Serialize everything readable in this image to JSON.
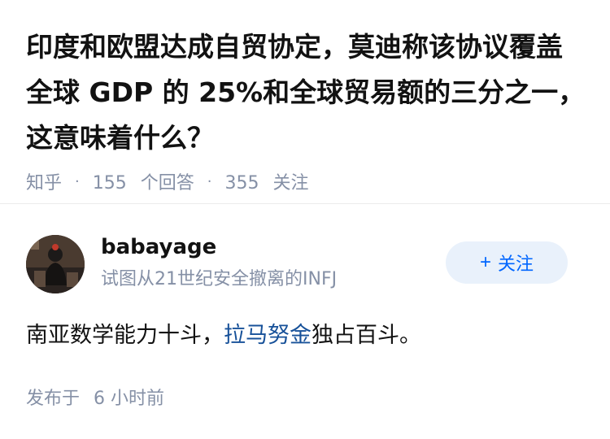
{
  "question": {
    "title": "印度和欧盟达成自贸协定，莫迪称该协议覆盖全球 GDP 的 25%和全球贸易额的三分之一，这意味着什么？",
    "source": "知乎",
    "answers_count": "155",
    "answers_label": "个回答",
    "followers_count": "355",
    "followers_label": "关注"
  },
  "author": {
    "name": "babayage",
    "bio": "试图从21世纪安全撤离的INFJ",
    "follow_plus": "+",
    "follow_label": "关注"
  },
  "answer": {
    "text_before": "南亚数学能力十斗，",
    "link_text": "拉马努金",
    "text_after": "独占百斗。"
  },
  "footer": {
    "posted_label": "发布于",
    "posted_time": "6 小时前"
  },
  "colors": {
    "accent": "#0066ff",
    "link": "#175199",
    "muted": "#8590a6",
    "follow_bg": "#e9f1fb"
  },
  "icons": {
    "meta_separator": "dot-separator"
  }
}
